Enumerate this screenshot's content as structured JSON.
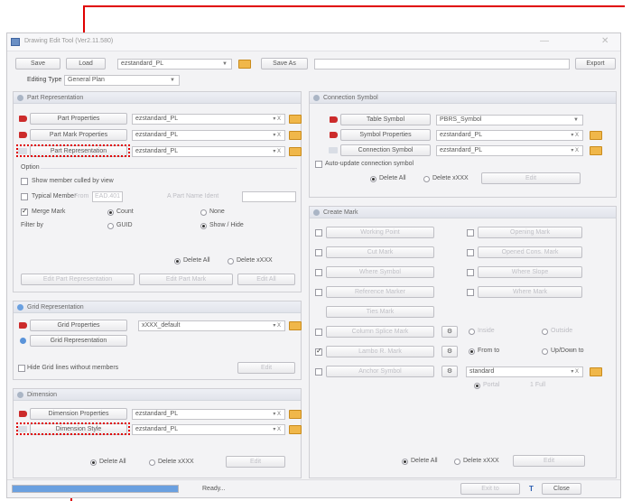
{
  "window": {
    "title": "Drawing Edit Tool (Ver2.11.580)",
    "minimize": "—",
    "close": "✕"
  },
  "toolbar": {
    "save": "Save",
    "load": "Load",
    "preset": "ezstandard_PL",
    "save_as": "Save As",
    "save_as_value": "",
    "export": "Export"
  },
  "editing_type": {
    "label": "Editing Type",
    "value": "General Plan"
  },
  "part_rep": {
    "title": "Part Representation",
    "props_btn": "Part Properties",
    "props_value": "ezstandard_PL",
    "mark_btn": "Part Mark Properties",
    "mark_value": "ezstandard_PL",
    "repr_btn": "Part Representation",
    "repr_value": "ezstandard_PL",
    "suffix": "▾ X",
    "option_label": "Option",
    "show_culled": "Show member culled by view",
    "typical": "Typical Member",
    "typical_from": "From",
    "typical_value": "EAD.401",
    "part_name": "A Part Name Ident",
    "merge_mark": "Merge Mark",
    "count": "Count",
    "none": "None",
    "filter_by": "Filter by",
    "guid": "GUID",
    "show_hide": "Show / Hide",
    "delete_all": "Delete All",
    "delete_xxx": "Delete xXXX",
    "edit_part_repr": "Edit Part Representation",
    "edit_part_mark": "Edit Part Mark",
    "edit": "Edit All"
  },
  "grid_rep": {
    "title": "Grid Representation",
    "props_btn": "Grid Properties",
    "props_value": "xXXX_default",
    "repr_btn": "Grid Representation",
    "hide_lines": "Hide Grid lines without members",
    "edit": "Edit"
  },
  "dimension": {
    "title": "Dimension",
    "props_btn": "Dimension Properties",
    "props_value": "ezstandard_PL",
    "style_btn": "Dimension Style",
    "style_value": "ezstandard_PL",
    "delete_all": "Delete All",
    "delete_xxx": "Delete xXXX",
    "edit": "Edit"
  },
  "connection": {
    "title": "Connection Symbol",
    "table_btn": "Table Symbol",
    "table_value": "PBRS_Symbol",
    "sym_props_btn": "Symbol Properties",
    "sym_props_value": "ezstandard_PL",
    "conn_btn": "Connection Symbol",
    "conn_value": "ezstandard_PL",
    "auto_update": "Auto-update connection symbol",
    "delete_all": "Delete All",
    "delete_xxx": "Delete xXXX",
    "edit": "Edit"
  },
  "create_mark": {
    "title": "Create Mark",
    "left_items": [
      "Working Point",
      "Cut Mark",
      "Where Symbol",
      "Reference Marker",
      "Ties Mark",
      "Column Splice Mark",
      "Lambo R. Mark",
      "Anchor Symbol"
    ],
    "right_items": [
      "Opening Mark",
      "Opened Cons. Mark",
      "Where Slope",
      "Where Mark"
    ],
    "inside": "Inside",
    "outside": "Outside",
    "from_to": "From to",
    "up_down": "Up/Down to",
    "standard": "standard",
    "portal": "Portal",
    "full": "1 Full",
    "delete_all": "Delete All",
    "delete_xxx": "Delete xXXX",
    "edit": "Edit"
  },
  "status": {
    "text": "Ready...",
    "progress": 1.0,
    "exit_to": "Exit to",
    "close": "Close"
  }
}
